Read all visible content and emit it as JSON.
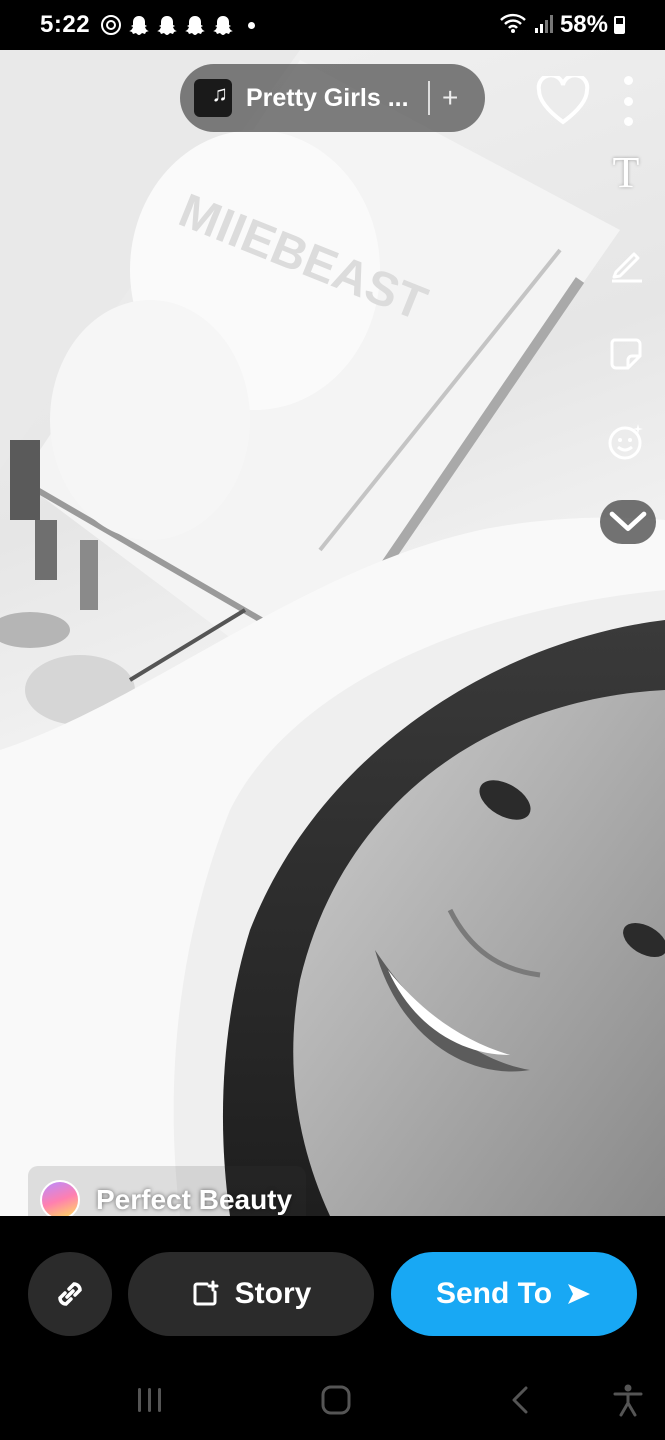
{
  "status_bar": {
    "time": "5:22",
    "icons": [
      "threads-icon",
      "snapchat-icon",
      "snapchat-icon",
      "snapchat-icon",
      "snapchat-icon",
      "dot-icon"
    ],
    "battery_percent": "58%",
    "right_icons": [
      "wifi-icon",
      "signal-icon",
      "battery-icon"
    ]
  },
  "editor": {
    "music": {
      "title": "Pretty Girls ...",
      "add_symbol": "+"
    },
    "tools": {
      "text_symbol": "T",
      "items": [
        "text-tool-icon",
        "pen-tool-icon",
        "sticker-tool-icon",
        "lens-tool-icon",
        "chevron-down-icon"
      ]
    },
    "lens": {
      "name": "Perfect Beauty"
    }
  },
  "actions": {
    "story_label": "Story",
    "send_label": "Send To",
    "colors": {
      "send": "#18a8f4",
      "secondary": "#2b2b2b"
    }
  },
  "nav_bar": {
    "items": [
      "recents-icon",
      "home-icon",
      "back-icon",
      "accessibility-icon"
    ]
  }
}
